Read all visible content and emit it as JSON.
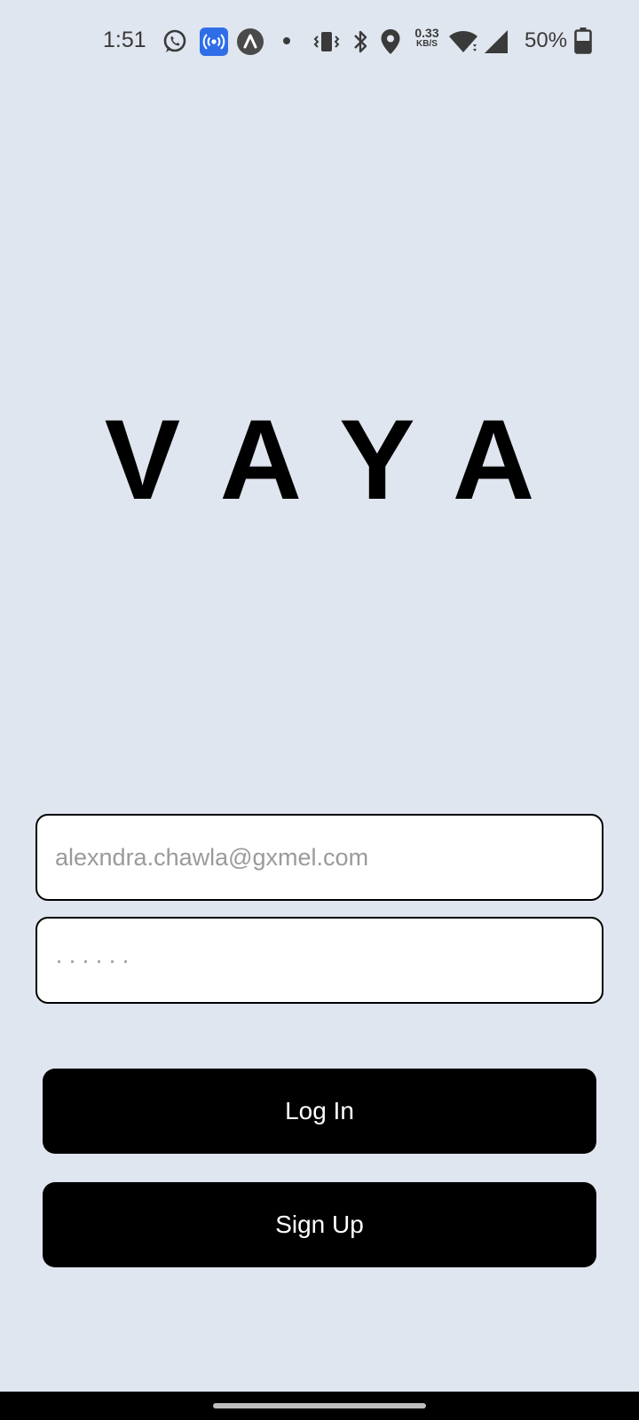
{
  "status_bar": {
    "time": "1:51",
    "icons": [
      "whatsapp-icon",
      "hotspot-icon",
      "app-arrow-icon",
      "notification-dot-icon",
      "vibrate-icon",
      "bluetooth-icon",
      "location-icon",
      "wifi-icon",
      "signal-icon",
      "battery-icon"
    ],
    "network_speed_value": "0.33",
    "network_speed_unit": "KB/S",
    "battery_percent": "50%"
  },
  "brand": {
    "logo": "VAYA"
  },
  "login_form": {
    "email_placeholder": "alexndra.chawla@gxmel.com",
    "password_placeholder": "······",
    "login_label": "Log In",
    "signup_label": "Sign Up"
  },
  "colors": {
    "background": "#e0e6ef",
    "button": "#000000",
    "button_text": "#ffffff",
    "hotspot_badge": "#2f6ee8"
  }
}
